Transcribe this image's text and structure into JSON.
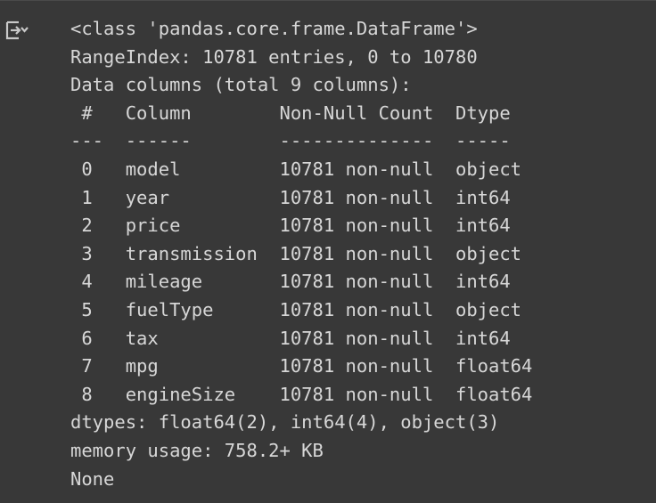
{
  "cell_output": {
    "icon": "output-toggle-icon",
    "lines": [
      "<class 'pandas.core.frame.DataFrame'>",
      "RangeIndex: 10781 entries, 0 to 10780",
      "Data columns (total 9 columns):",
      " #   Column        Non-Null Count  Dtype  ",
      "---  ------        --------------  -----  ",
      " 0   model         10781 non-null  object ",
      " 1   year          10781 non-null  int64  ",
      " 2   price         10781 non-null  int64  ",
      " 3   transmission  10781 non-null  object ",
      " 4   mileage       10781 non-null  int64  ",
      " 5   fuelType      10781 non-null  object ",
      " 6   tax           10781 non-null  int64  ",
      " 7   mpg           10781 non-null  float64",
      " 8   engineSize    10781 non-null  float64",
      "dtypes: float64(2), int64(4), object(3)",
      "memory usage: 758.2+ KB",
      "None"
    ]
  },
  "colors": {
    "background": "#383838",
    "text": "#d7d7d7",
    "icon": "#c9c9c9"
  }
}
